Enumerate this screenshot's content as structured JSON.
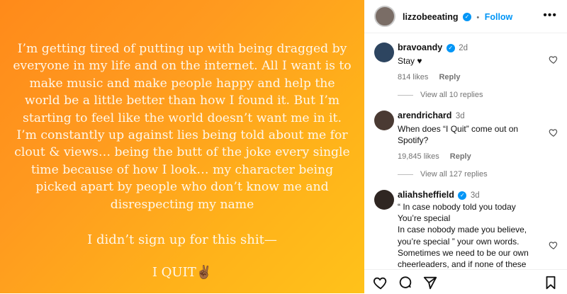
{
  "post": {
    "body_text": "I’m getting tired of putting up with being dragged by everyone in my life and on the internet. All I want is to make music and make people happy and help the world be a little better than how I found it. But I’m starting to feel like the world doesn’t want me in it. I’m constantly up against lies being told about me for clout & views… being the butt of the joke every single time because of how I look… my character being picked apart by people who don’t know me and disrespecting my name",
    "line2": "I didn’t sign up for this shit—",
    "line3": "I QUIT✌🏾"
  },
  "header": {
    "username": "lizzobeeating",
    "separator": "•",
    "follow_label": "Follow",
    "more_icon": "more-horizontal-icon"
  },
  "comments": [
    {
      "username": "bravoandy",
      "time": "2d",
      "text": "Stay ♥",
      "likes": "814 likes",
      "reply": "Reply",
      "view_replies": "View all 10 replies"
    },
    {
      "username": "arendrichard",
      "time": "3d",
      "text": "When does “I Quit” come out on Spotify?",
      "likes": "19,845 likes",
      "reply": "Reply",
      "view_replies": "View all 127 replies"
    },
    {
      "username": "aliahsheffield",
      "time": "3d",
      "text_lines": [
        "“ In case nobody told you today",
        "You’re special",
        "In case nobody made you believe,",
        "you’re special ” your own words.",
        "Sometimes we need to be our own",
        "cheerleaders, and if none of these"
      ]
    }
  ],
  "actions": {
    "icons": [
      "heart-icon",
      "comment-icon",
      "share-icon",
      "bookmark-icon"
    ]
  },
  "colors": {
    "accent": "#0095f6",
    "gradient_start": "#ff8a1a",
    "gradient_end": "#ffc21a"
  }
}
